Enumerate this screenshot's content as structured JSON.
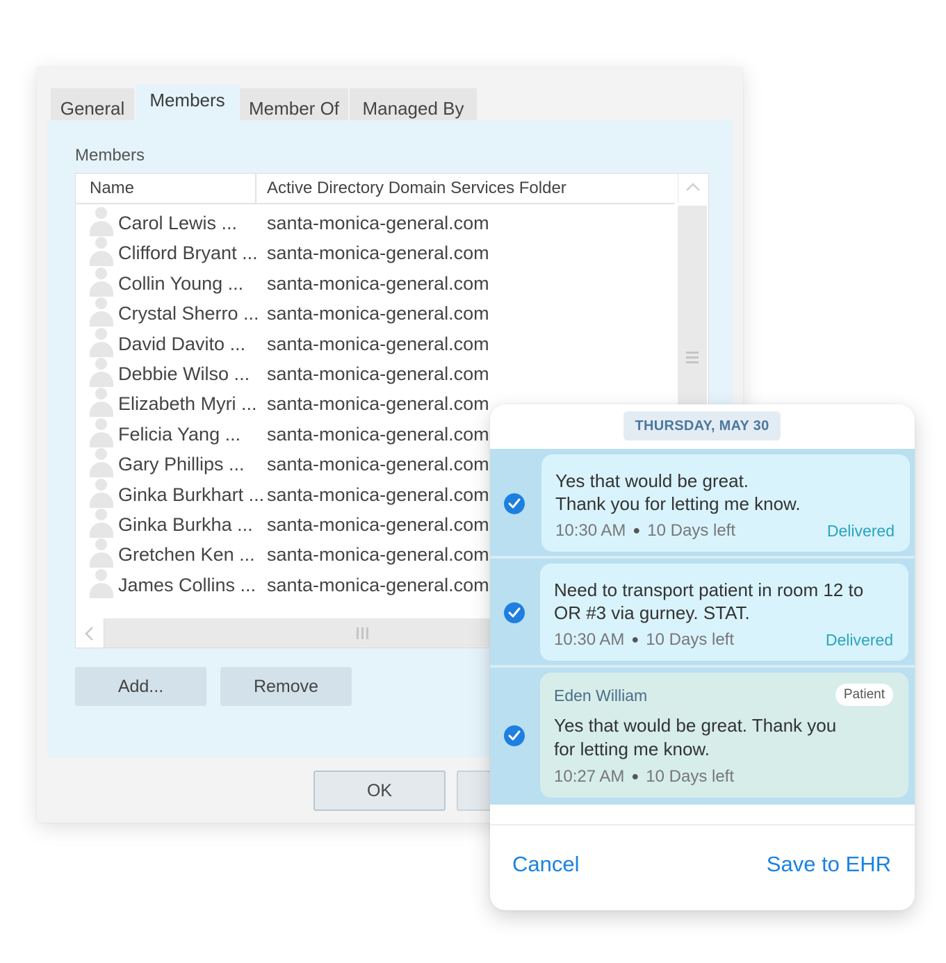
{
  "dialog": {
    "tabs": [
      "General",
      "Members",
      "Member Of",
      "Managed By"
    ],
    "active_tab": "Members",
    "section_label": "Members",
    "columns": [
      "Name",
      "Active Directory Domain Services Folder"
    ],
    "members": [
      {
        "name": "Carol Lewis ...",
        "folder": "santa-monica-general.com"
      },
      {
        "name": "Clifford Bryant ...",
        "folder": "santa-monica-general.com"
      },
      {
        "name": "Collin Young ...",
        "folder": "santa-monica-general.com"
      },
      {
        "name": "Crystal Sherro ...",
        "folder": "santa-monica-general.com"
      },
      {
        "name": "David Davito ...",
        "folder": "santa-monica-general.com"
      },
      {
        "name": "Debbie Wilso ...",
        "folder": "santa-monica-general.com"
      },
      {
        "name": "Elizabeth Myri ...",
        "folder": "santa-monica-general.com"
      },
      {
        "name": "Felicia Yang ...",
        "folder": "santa-monica-general.com"
      },
      {
        "name": "Gary Phillips ...",
        "folder": "santa-monica-general.com"
      },
      {
        "name": "Ginka Burkhart ...",
        "folder": "santa-monica-general.com"
      },
      {
        "name": "Ginka Burkha ...",
        "folder": "santa-monica-general.com"
      },
      {
        "name": "Gretchen Ken ...",
        "folder": "santa-monica-general.com"
      },
      {
        "name": "James Collins ...",
        "folder": "santa-monica-general.com"
      }
    ],
    "add_label": "Add...",
    "remove_label": "Remove",
    "ok_label": "OK"
  },
  "messages_card": {
    "date": "THURSDAY, MAY 30",
    "messages": [
      {
        "lines": [
          "Yes that would be great.",
          "Thank you for letting me know."
        ],
        "time": "10:30 AM",
        "expiry": "10 Days left",
        "status": "Delivered",
        "checked": true
      },
      {
        "lines": [
          "Need to transport patient in room 12 to",
          "OR #3 via gurney. STAT."
        ],
        "time": "10:30 AM",
        "expiry": "10 Days left",
        "status": "Delivered",
        "checked": true
      },
      {
        "sender": "Eden William",
        "tag": "Patient",
        "lines": [
          "Yes that would be great. Thank you",
          "for letting me know."
        ],
        "time": "10:27 AM",
        "expiry": "10 Days left",
        "checked": true
      }
    ],
    "cancel_label": "Cancel",
    "save_label": "Save to EHR"
  },
  "colors": {
    "panel_bg": "#e5f3fb",
    "accent_blue": "#1a82e2",
    "delivered": "#28a3c0",
    "selected_msg_bg": "#b9dff0"
  }
}
